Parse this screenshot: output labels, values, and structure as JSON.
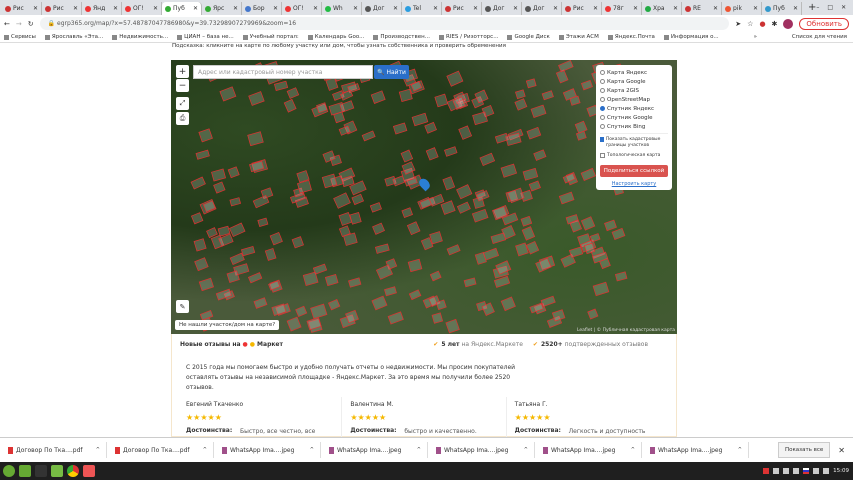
{
  "browser": {
    "tabs": [
      {
        "label": "Рис",
        "color": "#c33"
      },
      {
        "label": "Рис",
        "color": "#c33"
      },
      {
        "label": "Янд",
        "color": "#e33"
      },
      {
        "label": "ОГ!",
        "color": "#e33"
      },
      {
        "label": "Пуб",
        "color": "#3a3",
        "active": true
      },
      {
        "label": "Ярс",
        "color": "#3a3"
      },
      {
        "label": "Бор",
        "color": "#47c"
      },
      {
        "label": "ОГ!",
        "color": "#e33"
      },
      {
        "label": "Wh",
        "color": "#2b4"
      },
      {
        "label": "Дог",
        "color": "#555"
      },
      {
        "label": "Tel",
        "color": "#2a9de0"
      },
      {
        "label": "Рис",
        "color": "#c33"
      },
      {
        "label": "Дог",
        "color": "#555"
      },
      {
        "label": "Дог",
        "color": "#555"
      },
      {
        "label": "Рис",
        "color": "#c33"
      },
      {
        "label": "78г",
        "color": "#e33"
      },
      {
        "label": "Хра",
        "color": "#2a4"
      },
      {
        "label": "RE",
        "color": "#c33"
      },
      {
        "label": "pik",
        "color": "#e53"
      },
      {
        "label": "Пуб",
        "color": "#39c"
      }
    ],
    "url": "egrp365.org/map/?x=57.48787047786980&y=39.73298907279969&zoom=16",
    "reload_label": "Обновить",
    "bookmarks": [
      "Сервисы",
      "Ярославль «Эта...",
      "Недвижимость...",
      "ЦИАН – база не...",
      "Учебный портал:",
      "Календарь Goo...",
      "Производствен...",
      "RIES / Ризотторс...",
      "Google Диск",
      "Этажи АСМ",
      "Яндекс.Почта",
      "Информация о..."
    ],
    "reading_list": "Список для чтения"
  },
  "page": {
    "hint": "Подсказка: кликните на карте по любому участку или дом, чтобы узнать собственника и проверить обременения",
    "map": {
      "search_placeholder": "Адрес или кадастровый номер участка",
      "search_button": "Найти",
      "layers": [
        {
          "label": "Карта Яндекс",
          "selected": false
        },
        {
          "label": "Карта Google",
          "selected": false
        },
        {
          "label": "Карта 2GIS",
          "selected": false
        },
        {
          "label": "OpenStreetMap",
          "selected": false
        },
        {
          "label": "Спутник Яндекс",
          "selected": true
        },
        {
          "label": "Спутник Google",
          "selected": false
        },
        {
          "label": "Спутник Bing",
          "selected": false
        }
      ],
      "show_cadastral": {
        "label": "Показать кадастровые границы участков",
        "checked": true
      },
      "topo": {
        "label": "Топологическая карта",
        "checked": false
      },
      "share_button": "Поделиться ссылкой",
      "setup_link": "Настроить карту",
      "not_found": "Не нашли участок/дом на карте?",
      "attribution": "Leaflet | © Публичная кадастровая карта"
    },
    "reviews": {
      "title": "Новые отзывы на",
      "market": "Маркет",
      "years": "5 лет",
      "years_suffix": "на Яндекс.Маркете",
      "count": "2520+",
      "count_suffix": "подтвержденных отзывов",
      "intro": "С 2015 года мы помогаем быстро и удобно получать отчеты о недвижимости. Мы просим покупателей оставлять отзывы на независимой площадке - Яндекс.Маркет. За это время мы получили более 2520 отзывов.",
      "items": [
        {
          "name": "Евгений Ткаченко",
          "stars": 5,
          "label": "Достоинства:",
          "text": "Быстро, все честно, все что заказал получил."
        },
        {
          "name": "Валентина М.",
          "stars": 5,
          "label": "Достоинства:",
          "text": "быстро и качественно. Не ожидала."
        },
        {
          "name": "Татьяна Г.",
          "stars": 5,
          "label": "Достоинства:",
          "text": "Легкость и доступность интерфейса, надежность и качество информации , скорость"
        }
      ]
    }
  },
  "downloads": {
    "items": [
      {
        "name": "Договор По Тка....pdf",
        "type": "pdf"
      },
      {
        "name": "Договор По Тка....pdf",
        "type": "pdf"
      },
      {
        "name": "WhatsApp Ima....jpeg",
        "type": "img"
      },
      {
        "name": "WhatsApp Ima....jpeg",
        "type": "img"
      },
      {
        "name": "WhatsApp Ima....jpeg",
        "type": "img"
      },
      {
        "name": "WhatsApp Ima....jpeg",
        "type": "img"
      },
      {
        "name": "WhatsApp Ima....jpeg",
        "type": "img"
      }
    ],
    "show_all": "Показать все"
  },
  "taskbar": {
    "clock": "15:09"
  }
}
